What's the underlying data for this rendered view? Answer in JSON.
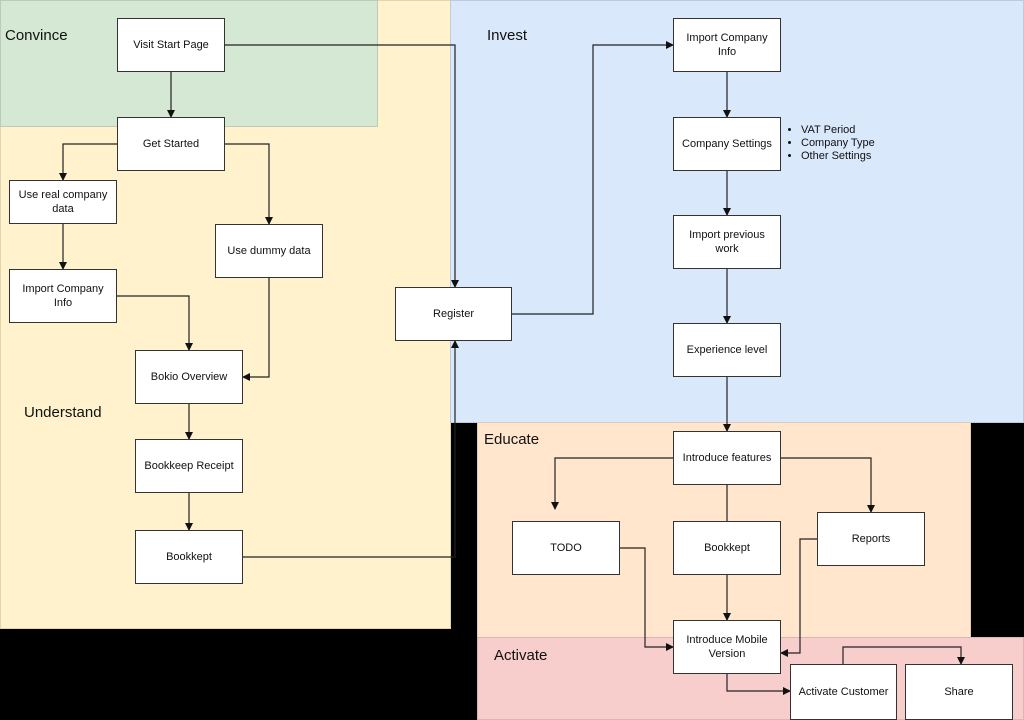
{
  "colors": {
    "understand": "#fff2cc",
    "convince": "#d5e8d4",
    "invest": "#dae8fc",
    "educate": "#ffe6cc",
    "activate": "#f8cecc",
    "background": "#000000"
  },
  "regions": {
    "convince": "Convince",
    "understand": "Understand",
    "invest": "Invest",
    "educate": "Educate",
    "activate": "Activate"
  },
  "nodes": {
    "visit_start_page": "Visit Start Page",
    "get_started": "Get Started",
    "use_real_company_data": "Use real company data",
    "use_dummy_data": "Use dummy data",
    "import_company_info_left": "Import Company Info",
    "bokio_overview": "Bokio Overview",
    "bookkeep_receipt": "Bookkeep Receipt",
    "bookkept_left": "Bookkept",
    "register": "Register",
    "import_company_info_right": "Import Company Info",
    "company_settings": "Company Settings",
    "import_previous_work": "Import previous work",
    "experience_level": "Experience level",
    "introduce_features": "Introduce features",
    "todo": "TODO",
    "bookkept_right": "Bookkept",
    "reports": "Reports",
    "introduce_mobile_version": "Introduce Mobile Version",
    "activate_customer": "Activate Customer",
    "share": "Share"
  },
  "company_settings_notes": [
    "VAT Period",
    "Company Type",
    "Other Settings"
  ]
}
